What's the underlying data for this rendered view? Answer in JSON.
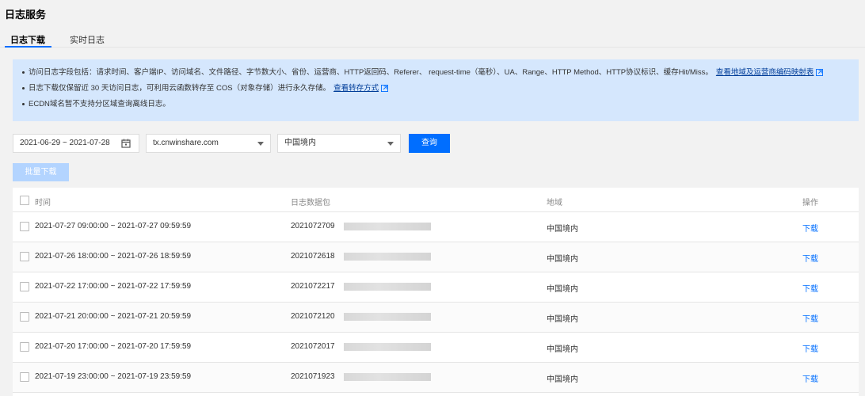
{
  "page": {
    "title": "日志服务"
  },
  "tabs": [
    {
      "label": "日志下载",
      "active": true
    },
    {
      "label": "实时日志",
      "active": false
    }
  ],
  "notice": {
    "line1": "访问日志字段包括：请求时间、客户端IP、访问域名、文件路径、字节数大小、省份、运营商、HTTP返回码、Referer、 request-time（毫秒）、UA、Range、HTTP Method、HTTP协议标识、缓存Hit/Miss。",
    "line1_link": "查看地域及运营商编码映射表",
    "line2": "日志下载仅保留近 30 天访问日志，可利用云函数转存至 COS（对象存储）进行永久存储。",
    "line2_link": "查看转存方式",
    "line3": "ECDN域名暂不支持分区域查询离线日志。"
  },
  "filters": {
    "date_range": "2021-06-29 ~ 2021-07-28",
    "domain": "tx.cnwinshare.com",
    "region": "中国境内"
  },
  "buttons": {
    "query": "查询",
    "batch_download": "批量下载"
  },
  "table": {
    "columns": [
      "时间",
      "日志数据包",
      "地域",
      "操作"
    ],
    "rows": [
      {
        "time": "2021-07-27 09:00:00 ~ 2021-07-27 09:59:59",
        "package": "2021072709",
        "region": "中国境内",
        "action": "下载"
      },
      {
        "time": "2021-07-26 18:00:00 ~ 2021-07-26 18:59:59",
        "package": "2021072618",
        "region": "中国境内",
        "action": "下载"
      },
      {
        "time": "2021-07-22 17:00:00 ~ 2021-07-22 17:59:59",
        "package": "2021072217",
        "region": "中国境内",
        "action": "下载"
      },
      {
        "time": "2021-07-21 20:00:00 ~ 2021-07-21 20:59:59",
        "package": "2021072120",
        "region": "中国境内",
        "action": "下载"
      },
      {
        "time": "2021-07-20 17:00:00 ~ 2021-07-20 17:59:59",
        "package": "2021072017",
        "region": "中国境内",
        "action": "下载"
      },
      {
        "time": "2021-07-19 23:00:00 ~ 2021-07-19 23:59:59",
        "package": "2021071923",
        "region": "中国境内",
        "action": "下载"
      }
    ]
  },
  "colors": {
    "primary": "#006eff",
    "notice_bg": "#d5e7fd",
    "disabled_btn": "#b3d4ff"
  }
}
